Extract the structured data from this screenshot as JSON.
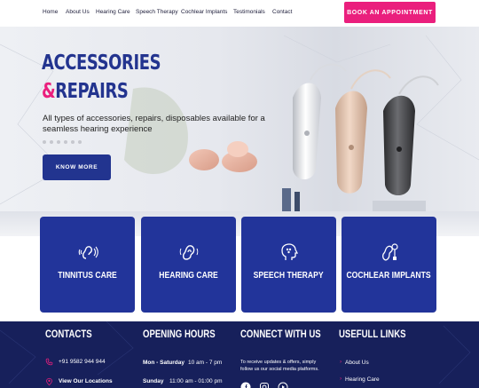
{
  "nav": {
    "items": [
      "Home",
      "About Us",
      "Hearing Care",
      "Speech Therapy",
      "Cochlear Implants",
      "Testimonials",
      "Contact"
    ],
    "cta": "BOOK AN APPOINTMENT"
  },
  "hero": {
    "title_line1": "ACCESSORIES",
    "title_amp": "&",
    "title_line2": "REPAIRS",
    "subtitle": "All types of accessories, repairs, disposables available for a seamless hearing experience",
    "cta": "KNOW MORE"
  },
  "services": [
    {
      "label": "TINNITUS CARE",
      "icon": "ear-waves-icon"
    },
    {
      "label": "HEARING CARE",
      "icon": "ear-icon"
    },
    {
      "label": "SPEECH THERAPY",
      "icon": "speech-head-icon"
    },
    {
      "label": "COCHLEAR IMPLANTS",
      "icon": "cochlear-implant-icon"
    }
  ],
  "footer": {
    "contacts": {
      "heading": "CONTACTS",
      "phone": "+91 9582 944 944",
      "locations": "View Our Locations"
    },
    "hours": {
      "heading": "OPENING HOURS",
      "row1_day": "Mon - Saturday",
      "row1_time": "10 am - 7 pm",
      "row2_day": "Sunday",
      "row2_time": "11:00 am - 01:00 pm"
    },
    "connect": {
      "heading": "CONNECT WITH US",
      "line1": "To receive updates & offers, simply",
      "line2": "follow us our social media platforms."
    },
    "links": {
      "heading": "USEFULL LINKS",
      "items": [
        "About Us",
        "Hearing Care"
      ]
    }
  },
  "colors": {
    "brand_blue": "#22349a",
    "accent_pink": "#ea1f7d",
    "footer_navy": "#17205b"
  }
}
